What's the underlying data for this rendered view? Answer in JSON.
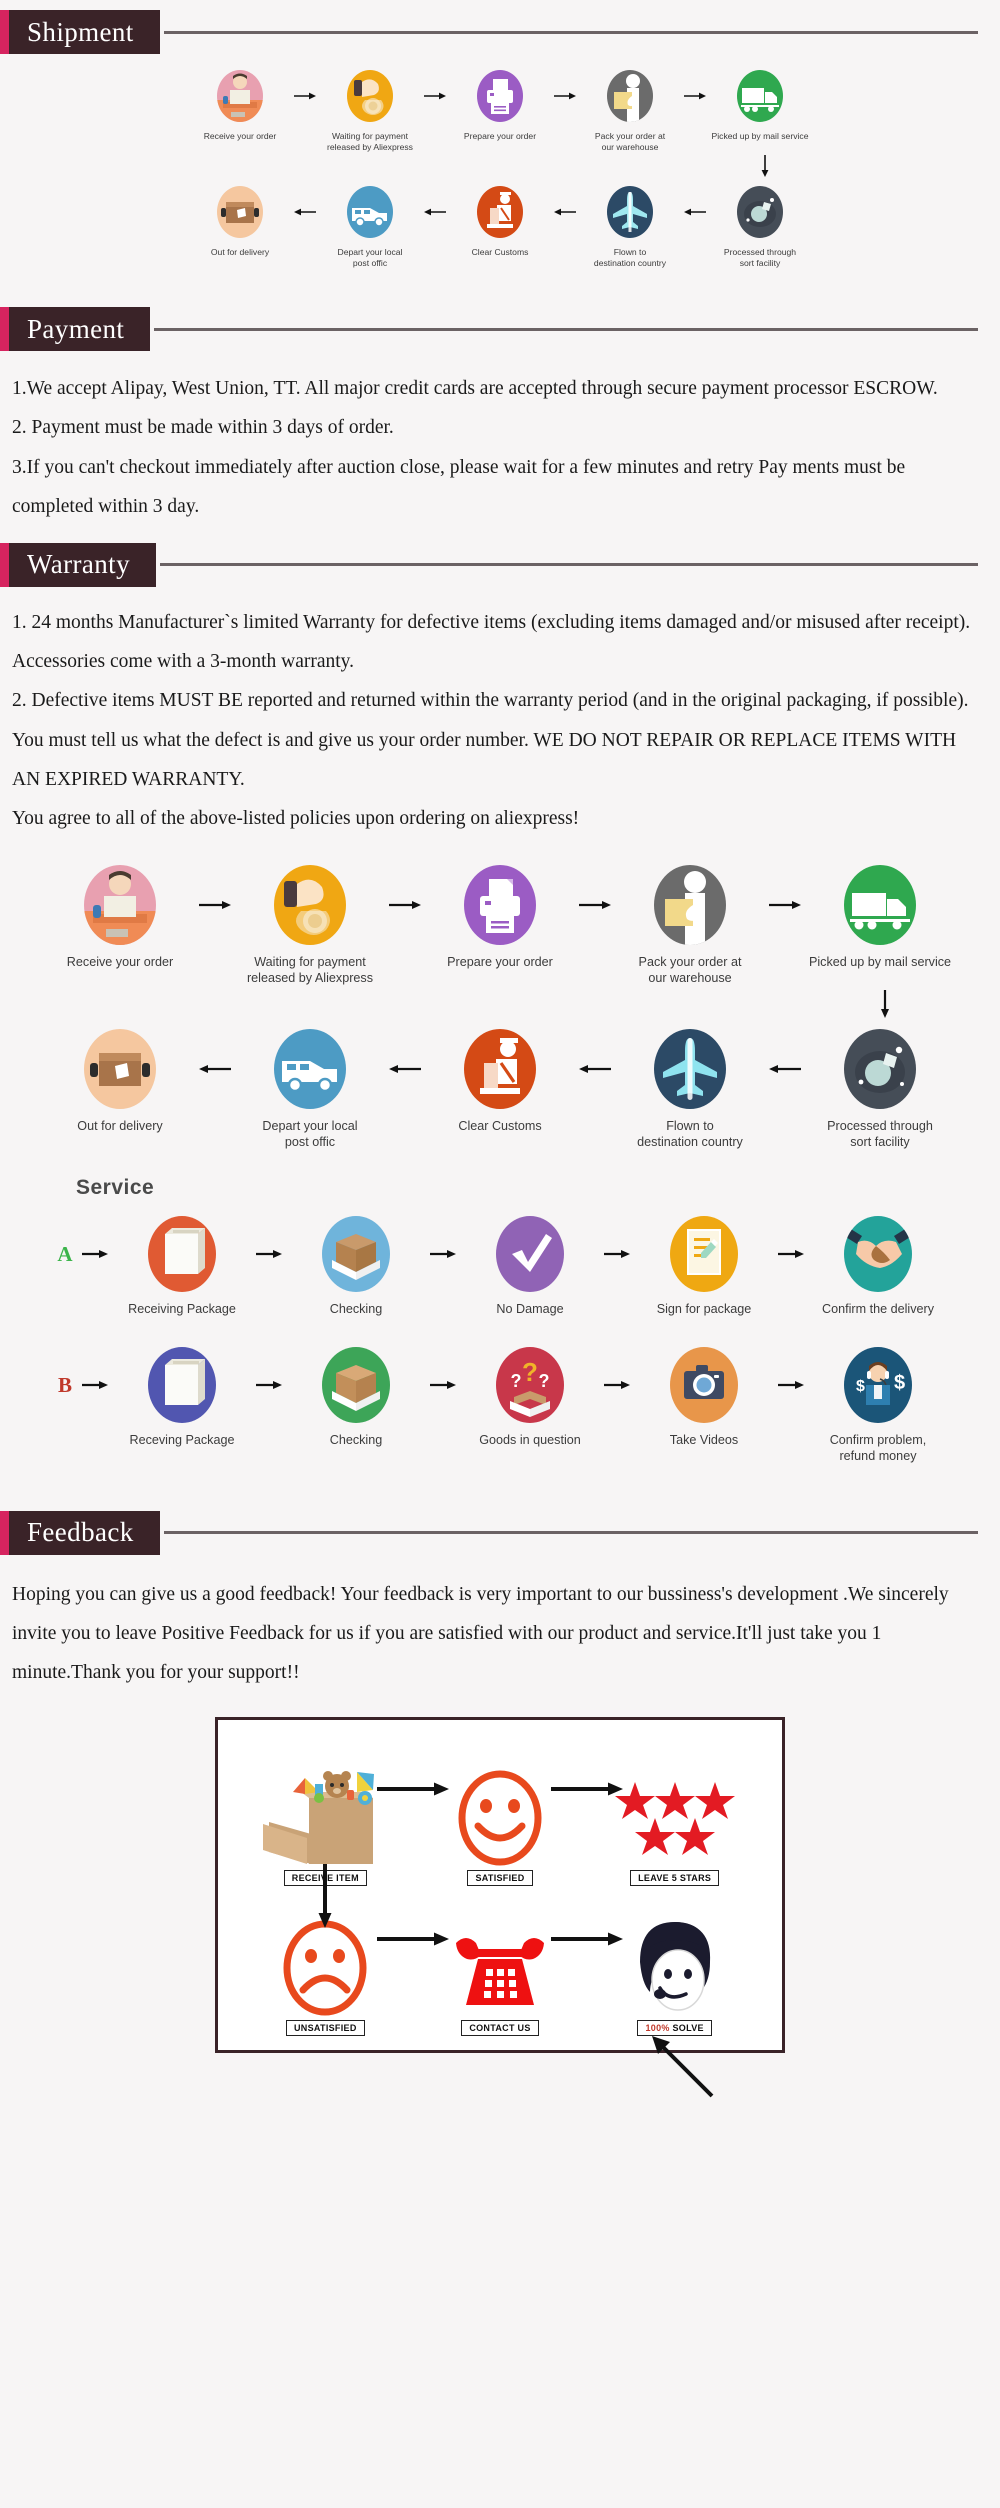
{
  "sections": {
    "shipment": {
      "title": "Shipment"
    },
    "payment": {
      "title": "Payment"
    },
    "warranty": {
      "title": "Warranty"
    },
    "feedback": {
      "title": "Feedback"
    }
  },
  "payment_text": {
    "line1": "1.We accept Alipay, West Union, TT. All major credit cards are accepted through secure payment processor ESCROW.",
    "line2": "2. Payment must be made within 3 days of order.",
    "line3": "3.If you can't checkout immediately after auction close, please wait for a few minutes and retry Pay ments must be completed within 3 day."
  },
  "warranty_text": {
    "line1": "1. 24 months Manufacturer`s limited Warranty for defective items (excluding items damaged and/or misused after receipt). Accessories come with a 3-month warranty.",
    "line2": "2. Defective items MUST BE reported and returned within the warranty period (and in the original packaging, if possible). You must tell us what the defect is and give us your order number. WE DO NOT REPAIR OR REPLACE ITEMS WITH AN EXPIRED WARRANTY.",
    "line3": "You agree to all of the above-listed policies upon ordering on aliexpress!"
  },
  "feedback_text": {
    "paragraph": "Hoping you can give us a good feedback! Your feedback is very important to our bussiness's development .We sincerely invite you to leave Positive Feedback for us if you are satisfied with our product and service.It'll just take you 1 minute.Thank you for your support!!"
  },
  "shipment_flow": {
    "row1": [
      {
        "label": "Receive your order",
        "icon": "person-at-desk-icon",
        "color": "#e8a0b0"
      },
      {
        "label": "Waiting for payment\nreleased by Aliexpress",
        "icon": "hand-with-coin-icon",
        "color": "#f0a713"
      },
      {
        "label": "Prepare your order",
        "icon": "printer-icon",
        "color": "#9b5cc4"
      },
      {
        "label": "Pack your order at\nour warehouse",
        "icon": "worker-with-box-icon",
        "color": "#6b6b6b"
      },
      {
        "label": "Picked up by mail service",
        "icon": "truck-icon",
        "color": "#2fa84f"
      }
    ],
    "row2": [
      {
        "label": "Out for delivery",
        "icon": "parcel-box-icon",
        "color": "#f5c79f"
      },
      {
        "label": "Depart your local\npost offic",
        "icon": "delivery-van-icon",
        "color": "#4d9bc4"
      },
      {
        "label": "Clear  Customs",
        "icon": "customs-officer-icon",
        "color": "#d44a15"
      },
      {
        "label": "Flown to\ndestination country",
        "icon": "airplane-icon",
        "color": "#2c4a66"
      },
      {
        "label": "Processed through\nsort facility",
        "icon": "sorting-facility-icon",
        "color": "#454d57"
      }
    ],
    "arrow_right": "arrow-right-icon",
    "arrow_left": "arrow-left-icon",
    "arrow_down": "arrow-down-icon"
  },
  "service": {
    "title": "Service",
    "branch_a": {
      "letter": "A",
      "letter_color": "#3cb44b"
    },
    "branch_b": {
      "letter": "B",
      "letter_color": "#c0392b"
    },
    "row_a": [
      {
        "label": "Receiving Package",
        "icon": "package-icon",
        "color": "#e05a33"
      },
      {
        "label": "Checking",
        "icon": "open-box-icon",
        "color": "#6fb4db"
      },
      {
        "label": "No Damage",
        "icon": "check-mark-icon",
        "color": "#9063b5"
      },
      {
        "label": "Sign for package",
        "icon": "signed-document-icon",
        "color": "#efa812"
      },
      {
        "label": "Confirm the delivery",
        "icon": "handshake-icon",
        "color": "#23a39a"
      }
    ],
    "row_b": [
      {
        "label": "Receving Package",
        "icon": "package-icon",
        "color": "#5156b0"
      },
      {
        "label": "Checking",
        "icon": "open-box-icon",
        "color": "#3da558"
      },
      {
        "label": "Goods in question",
        "icon": "question-marks-icon",
        "color": "#c8374a"
      },
      {
        "label": "Take Videos",
        "icon": "camera-icon",
        "color": "#e8964a"
      },
      {
        "label": "Confirm problem,\nrefund money",
        "icon": "support-agent-money-icon",
        "color": "#1b5578"
      }
    ]
  },
  "feedback_diagram": {
    "cells": [
      {
        "tag": "RECEIVE ITEM",
        "icon": "toy-box-icon"
      },
      {
        "tag": "SATISFIED",
        "icon": "smiley-face-icon"
      },
      {
        "tag": "LEAVE 5 STARS",
        "icon": "five-stars-icon"
      },
      {
        "tag": "UNSATISFIED",
        "icon": "sad-face-icon"
      },
      {
        "tag": "CONTACT US",
        "icon": "telephone-icon"
      },
      {
        "tag": "100% SOLVE",
        "icon": "support-agent-icon",
        "tag_prefix": "100%",
        "tag_suffix": " SOLVE"
      }
    ],
    "accent_red": "#e8491d",
    "phone_red": "#ee1111",
    "star_red": "#e31b23"
  }
}
